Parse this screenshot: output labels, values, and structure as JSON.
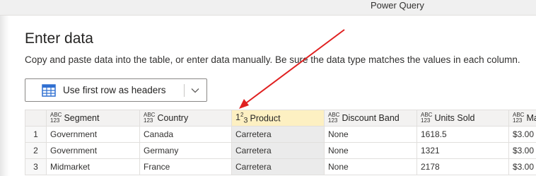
{
  "window": {
    "title": "Power Query"
  },
  "dialog": {
    "heading": "Enter data",
    "description": "Copy and paste data into the table, or enter data manually. Be sure the data type matches the values in each column.",
    "first_row_button": {
      "label": "Use first row as headers",
      "icon": "table-icon",
      "dropdown_icon": "chevron-down-icon"
    }
  },
  "table": {
    "columns": [
      {
        "type_line1": "ABC",
        "type_line2": "123",
        "name": "Segment"
      },
      {
        "type_line1": "ABC",
        "type_line2": "123",
        "name": "Country"
      },
      {
        "type_main": "1",
        "type_sup": "2",
        "type_sub": "3",
        "name": "Product"
      },
      {
        "type_line1": "ABC",
        "type_line2": "123",
        "name": "Discount Band"
      },
      {
        "type_line1": "ABC",
        "type_line2": "123",
        "name": "Units Sold"
      },
      {
        "type_line1": "ABC",
        "type_line2": "123",
        "name": "Ma"
      }
    ],
    "rows": [
      {
        "num": "1",
        "cells": [
          "Government",
          "Canada",
          "Carretera",
          "None",
          "1618.5",
          "$3.00"
        ]
      },
      {
        "num": "2",
        "cells": [
          "Government",
          "Germany",
          "Carretera",
          "None",
          "1321",
          "$3.00"
        ]
      },
      {
        "num": "3",
        "cells": [
          "Midmarket",
          "France",
          "Carretera",
          "None",
          "2178",
          "$3.00"
        ]
      }
    ]
  },
  "colors": {
    "selected_header": "#fdf0c2",
    "selected_column": "#ebebeb",
    "annotation_arrow": "#e02020",
    "table_icon": "#2f6fd1"
  }
}
